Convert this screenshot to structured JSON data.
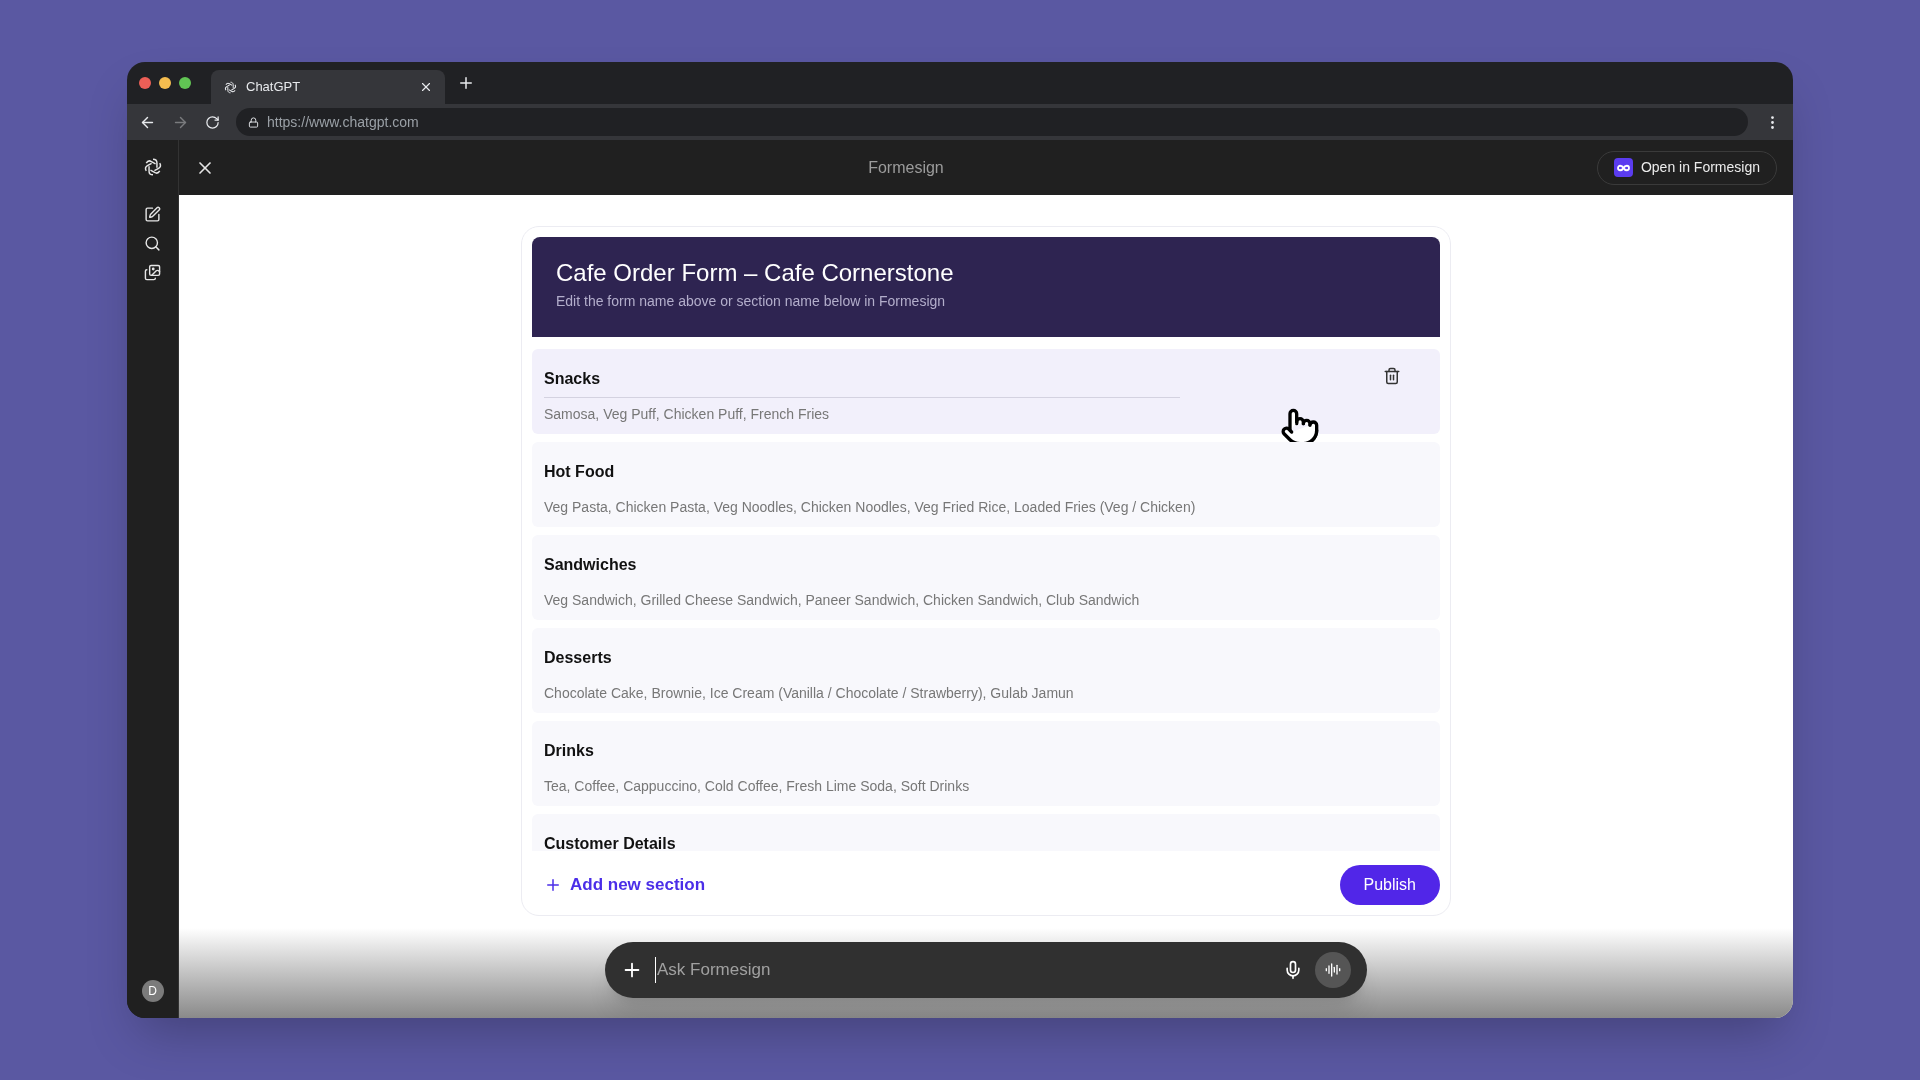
{
  "browser": {
    "tab": {
      "title": "ChatGPT"
    },
    "url": "https://www.chatgpt.com"
  },
  "app_header": {
    "title": "Formesign",
    "open_button": "Open in Formesign"
  },
  "sidebar": {
    "avatar": "D"
  },
  "form": {
    "title": "Cafe Order Form – Cafe Cornerstone",
    "subtitle": "Edit the form name above or section name below in Formesign",
    "sections": [
      {
        "name": "Snacks",
        "items": "Samosa, Veg Puff, Chicken Puff, French Fries",
        "selected": true
      },
      {
        "name": "Hot Food",
        "items": "Veg Pasta, Chicken Pasta, Veg Noodles, Chicken Noodles, Veg Fried Rice, Loaded Fries (Veg / Chicken)",
        "selected": false
      },
      {
        "name": "Sandwiches",
        "items": "Veg Sandwich, Grilled Cheese Sandwich, Paneer Sandwich, Chicken Sandwich, Club Sandwich",
        "selected": false
      },
      {
        "name": "Desserts",
        "items": "Chocolate Cake, Brownie, Ice Cream (Vanilla / Chocolate / Strawberry), Gulab Jamun",
        "selected": false
      },
      {
        "name": "Drinks",
        "items": "Tea, Coffee, Cappuccino, Cold Coffee, Fresh Lime Soda, Soft Drinks",
        "selected": false
      },
      {
        "name": "Customer Details",
        "selected": false
      }
    ],
    "add_section": "Add new section",
    "publish": "Publish"
  },
  "chat": {
    "placeholder": "Ask Formesign"
  }
}
